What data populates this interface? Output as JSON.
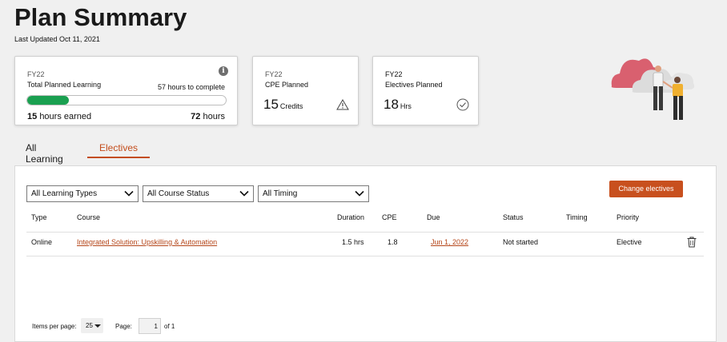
{
  "page": {
    "title": "Plan Summary",
    "last_updated": "Last Updated Oct 11, 2021"
  },
  "cards": {
    "total": {
      "fy": "FY22",
      "label": "Total Planned Learning",
      "hours_to_complete": "57 hours to complete",
      "earned_value": "15",
      "earned_suffix": "hours earned",
      "total_value": "72",
      "total_suffix": "hours",
      "progress_fraction": 0.21
    },
    "cpe": {
      "fy": "FY22",
      "label": "CPE Planned",
      "value": "15",
      "unit": "Credits",
      "icon": "warning-icon"
    },
    "electives": {
      "fy": "FY22",
      "label": "Electives Planned",
      "value": "18",
      "unit": "Hrs",
      "icon": "check-circle-icon"
    }
  },
  "tabs": [
    {
      "label": "All Learning",
      "active": false
    },
    {
      "label": "Electives",
      "active": true
    }
  ],
  "filters": {
    "types": "All Learning Types",
    "status": "All Course Status",
    "timing": "All Timing"
  },
  "actions": {
    "change_electives": "Change electives"
  },
  "table": {
    "headers": {
      "type": "Type",
      "course": "Course",
      "duration": "Duration",
      "cpe": "CPE",
      "due": "Due",
      "status": "Status",
      "timing": "Timing",
      "priority": "Priority"
    },
    "rows": [
      {
        "type": "Online",
        "course": "Integrated Solution: Upskilling & Automation",
        "duration": "1.5 hrs",
        "cpe": "1.8",
        "due": "Jun 1, 2022",
        "status": "Not started",
        "timing": "",
        "priority": "Elective"
      }
    ]
  },
  "pager": {
    "items_per_page_label": "Items per page:",
    "items_per_page": "25",
    "page_label": "Page:",
    "page": "1",
    "of_total": "of 1"
  },
  "colors": {
    "accent": "#c8501e",
    "progress": "#1aa050",
    "link": "#b5461a"
  }
}
